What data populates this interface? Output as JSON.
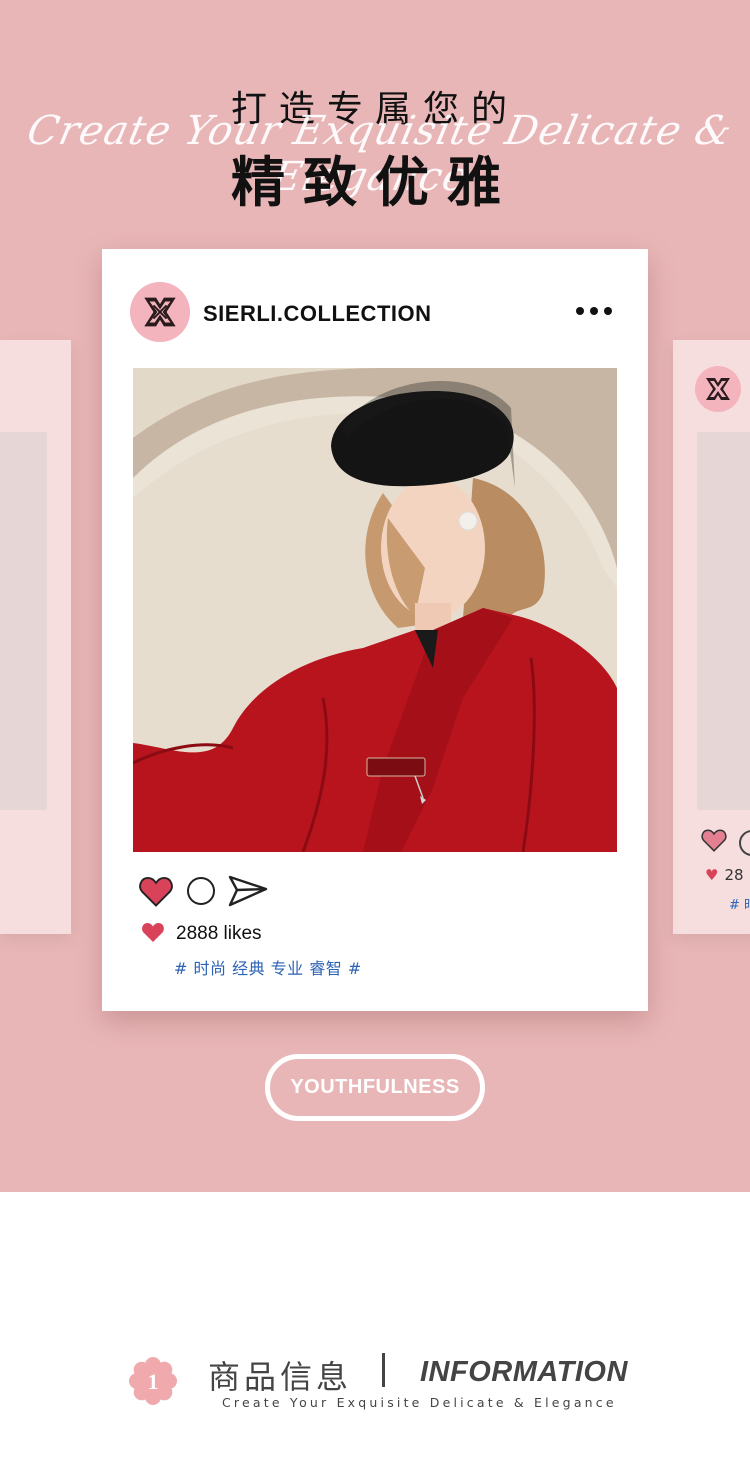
{
  "hero": {
    "title_small": "打造专属您的",
    "script_line": "Create Your Exquisite Delicate & Elegance",
    "title_big": "精致优雅"
  },
  "post": {
    "handle": "SIERLI.COLLECTION",
    "likes_text": "2888 likes",
    "tags": "# 时尚 经典 专业 睿智 #"
  },
  "side_card": {
    "likes_fragment": "28",
    "tags_fragment": "# 时"
  },
  "badge": {
    "label": "YOUTHFULNESS"
  },
  "info": {
    "number": "1",
    "title_cn": "商品信息",
    "title_en": "INFORMATION",
    "subtitle": "Create Your Exquisite Delicate & Elegance"
  },
  "icons": {
    "logo": "sierli-logo-icon",
    "more": "more-dots-icon",
    "like": "heart-icon",
    "comment": "comment-circle-icon",
    "share": "send-icon",
    "flower": "flower-number-icon"
  },
  "colors": {
    "background_pink": "#e9b6b7",
    "card_white": "#ffffff",
    "heart_red": "#d9435a",
    "tag_blue": "#2b63b6",
    "coat_red": "#b8141e",
    "flower_pink": "#f0a9ad"
  }
}
